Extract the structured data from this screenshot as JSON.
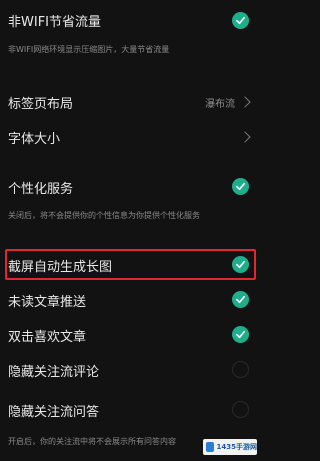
{
  "settings": {
    "nonwifi_save": {
      "label": "非WIFI节省流量",
      "desc": "非WIFI网络环境显示压缩图片，大量节省流量",
      "checked": true
    },
    "tab_layout": {
      "label": "标签页布局",
      "value": "瀑布流"
    },
    "font_size": {
      "label": "字体大小"
    },
    "personalize": {
      "label": "个性化服务",
      "desc": "关闭后，将不会提供你的个性信息为你提供个性化服务",
      "checked": true
    },
    "screenshot_long": {
      "label": "截屏自动生成长图",
      "checked": true
    },
    "unread_push": {
      "label": "未读文章推送",
      "checked": true
    },
    "double_tap_like": {
      "label": "双击喜欢文章",
      "checked": true
    },
    "hide_follow_comments": {
      "label": "隐藏关注流评论",
      "checked": false
    },
    "hide_follow_qa": {
      "label": "隐藏关注流问答",
      "checked": false
    },
    "footer_desc": "开启后，你的关注流中将不会展示所有问答内容"
  },
  "watermark": {
    "text": "1435手游网"
  },
  "colors": {
    "accent": "#1fae8b",
    "highlight": "#e0282e",
    "background": "#121212"
  }
}
